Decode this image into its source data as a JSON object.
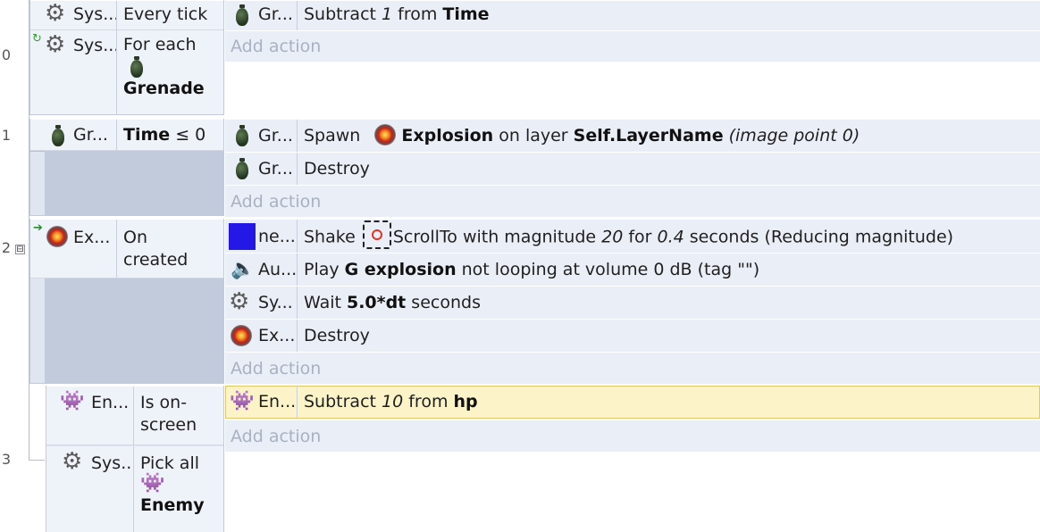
{
  "line_numbers": [
    "0",
    "1",
    "2",
    "3"
  ],
  "collapse_glyph": "⊟",
  "colors": {
    "condition_block": "#dfe6f1",
    "action_row": "#eaeff7",
    "selected_action": "#fdf3c8",
    "add_action_text": "#a9b2c2"
  },
  "events": {
    "e0": {
      "conditions": [
        {
          "icon": "gear-icon",
          "object": "Sys...",
          "text": "Every tick"
        },
        {
          "icon": "gear-icon",
          "object": "Sys...",
          "pre": "For each",
          "param": "Grenade"
        }
      ],
      "actions": [
        {
          "icon": "grenade-icon",
          "object": "Gr...",
          "pre": "Subtract ",
          "num": "1",
          "mid": " from ",
          "bold": "Time"
        }
      ],
      "add_action": "Add action"
    },
    "e1": {
      "conditions": [
        {
          "icon": "grenade-icon",
          "object": "Gr...",
          "bold": "Time",
          "post": " ≤ 0"
        }
      ],
      "actions": [
        {
          "icon": "grenade-icon",
          "object": "Gr...",
          "pre": "Spawn ",
          "bold": "Explosion",
          "mid": " on layer ",
          "bold2": "Self.LayerName",
          "italic": " (image point 0)"
        },
        {
          "icon": "grenade-icon",
          "object": "Gr...",
          "text": "Destroy"
        }
      ],
      "add_action": "Add action"
    },
    "e2": {
      "conditions": [
        {
          "icon": "explosion-icon",
          "object": "Ex...",
          "text1": "On",
          "text2": "created"
        }
      ],
      "actions": [
        {
          "icon": "blue-square-icon",
          "object": "ne...",
          "pre": "Shake ",
          "param": "ScrollTo",
          "mid": " with magnitude ",
          "num": "20",
          "mid2": " for ",
          "num2": "0.4",
          "post": " seconds (Reducing magnitude)"
        },
        {
          "icon": "speaker-icon",
          "object": "Au...",
          "pre": "Play ",
          "bold": "G explosion",
          "post": " not looping at volume 0 dB (tag \"\")"
        },
        {
          "icon": "gear-icon",
          "object": "Sy...",
          "pre": "Wait ",
          "bold": "5.0*dt",
          "post": " seconds"
        },
        {
          "icon": "explosion-icon",
          "object": "Ex...",
          "text": "Destroy"
        }
      ],
      "add_action": "Add action"
    },
    "e3": {
      "conditions": [
        {
          "icon": "invader-icon",
          "object": "En...",
          "text1": "Is on-",
          "text2": "screen"
        },
        {
          "icon": "gear-icon",
          "object": "Sys...",
          "pre": "Pick all",
          "param": "Enemy"
        }
      ],
      "actions": [
        {
          "icon": "invader-icon",
          "object": "En...",
          "pre": "Subtract ",
          "num": "10",
          "mid": " from ",
          "bold": "hp"
        }
      ],
      "add_action": "Add action"
    }
  }
}
